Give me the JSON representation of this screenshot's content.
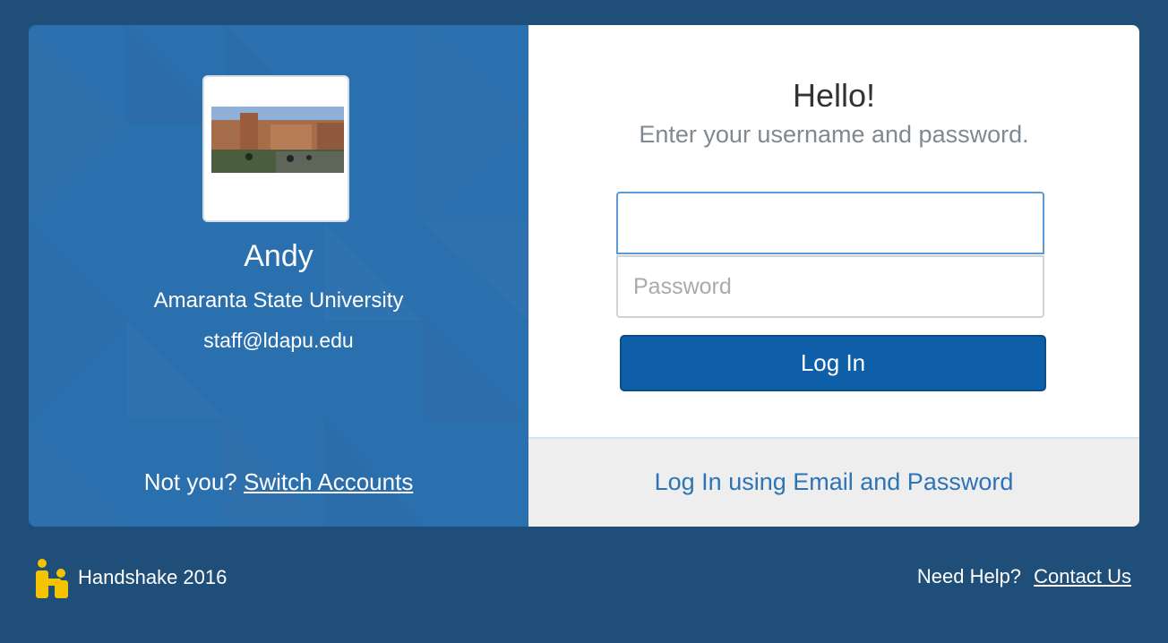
{
  "colors": {
    "background": "#1f4f79",
    "left_panel": "#2a6fae",
    "primary_button": "#0f5fa8",
    "link": "#2d74b6",
    "logo_yellow": "#f5c400"
  },
  "profile": {
    "name": "Andy",
    "school": "Amaranta State University",
    "email": "staff@ldapu.edu",
    "image_icon": "campus-photo",
    "not_you_text": "Not you?",
    "switch_link": "Switch Accounts"
  },
  "login": {
    "title": "Hello!",
    "subtitle": "Enter your username and password.",
    "username_value": "",
    "password_placeholder": "Password",
    "submit_label": "Log In",
    "alt_link": "Log In using Email and Password"
  },
  "footer": {
    "logo_icon": "handshake-logo",
    "brand": "Handshake 2016",
    "help_text": "Need Help?",
    "contact_link": "Contact Us"
  }
}
